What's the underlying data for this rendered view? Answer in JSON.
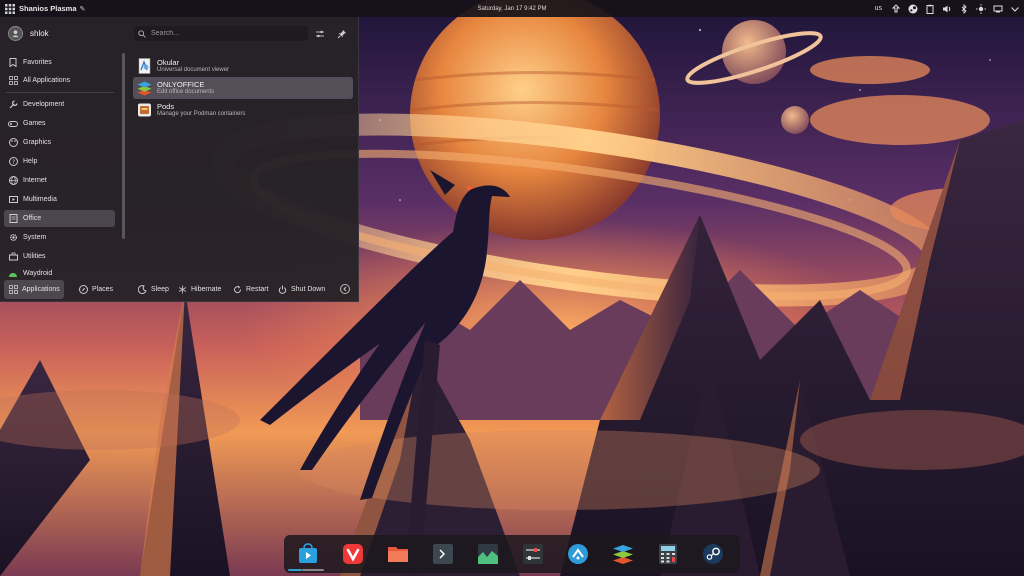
{
  "top_panel": {
    "title": "Shanios Plasma",
    "clock": "Saturday, Jan 17  9:42 PM",
    "keyboard_layout": "us",
    "tray_icons": [
      "update-icon",
      "steam-icon",
      "clipboard-icon",
      "volume-icon",
      "bluetooth-icon",
      "brightness-icon",
      "network-icon",
      "expand-tray-icon"
    ]
  },
  "menu": {
    "user_name": "shlok",
    "search_placeholder": "Search...",
    "categories": [
      {
        "label": "Favorites",
        "icon": "bookmark-icon"
      },
      {
        "label": "All Applications",
        "icon": "grid-icon"
      },
      {
        "label": "Development",
        "icon": "wrench-icon"
      },
      {
        "label": "Games",
        "icon": "gamepad-icon"
      },
      {
        "label": "Graphics",
        "icon": "palette-icon"
      },
      {
        "label": "Help",
        "icon": "help-icon"
      },
      {
        "label": "Internet",
        "icon": "globe-icon"
      },
      {
        "label": "Multimedia",
        "icon": "multimedia-icon"
      },
      {
        "label": "Office",
        "icon": "office-icon"
      },
      {
        "label": "System",
        "icon": "gear-icon"
      },
      {
        "label": "Utilities",
        "icon": "toolbox-icon"
      },
      {
        "label": "Waydroid",
        "icon": "android-icon"
      }
    ],
    "selected_category": "Office",
    "apps": [
      {
        "name": "Okular",
        "description": "Universal document viewer"
      },
      {
        "name": "ONLYOFFICE",
        "description": "Edit office documents"
      },
      {
        "name": "Pods",
        "description": "Manage your Podman containers"
      }
    ],
    "footer": {
      "applications": "Applications",
      "places": "Places",
      "sleep": "Sleep",
      "hibernate": "Hibernate",
      "restart": "Restart",
      "shutdown": "Shut Down"
    }
  },
  "dock": {
    "items": [
      "discover-icon",
      "vivaldi-icon",
      "file-manager-icon",
      "terminal-icon",
      "system-monitor-icon",
      "settings-icon",
      "kde-connect-icon",
      "onlyoffice-icon",
      "calculator-icon",
      "steam-icon"
    ]
  },
  "colors": {
    "accent": "#2ea3c9",
    "menu_bg": "#262226",
    "selection": "#6e6a72"
  }
}
